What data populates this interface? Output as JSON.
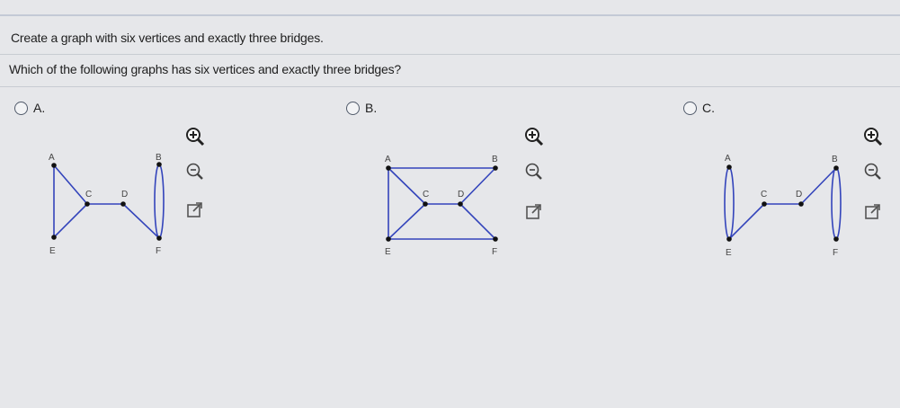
{
  "question": {
    "title": "Create a graph with six vertices and exactly three bridges.",
    "prompt": "Which of the following graphs has six vertices and exactly three bridges?"
  },
  "options": [
    {
      "label": "A.",
      "vertices": [
        "A",
        "B",
        "C",
        "D",
        "E",
        "F"
      ]
    },
    {
      "label": "B.",
      "vertices": [
        "A",
        "B",
        "C",
        "D",
        "E",
        "F"
      ]
    },
    {
      "label": "C.",
      "vertices": [
        "A",
        "B",
        "C",
        "D",
        "E",
        "F"
      ]
    }
  ],
  "tools": [
    "zoom-in-icon",
    "zoom-out-icon",
    "popout-icon"
  ],
  "colors": {
    "edge": "#3344bb",
    "vertex": "#111111",
    "radio_border": "#505a6a"
  }
}
